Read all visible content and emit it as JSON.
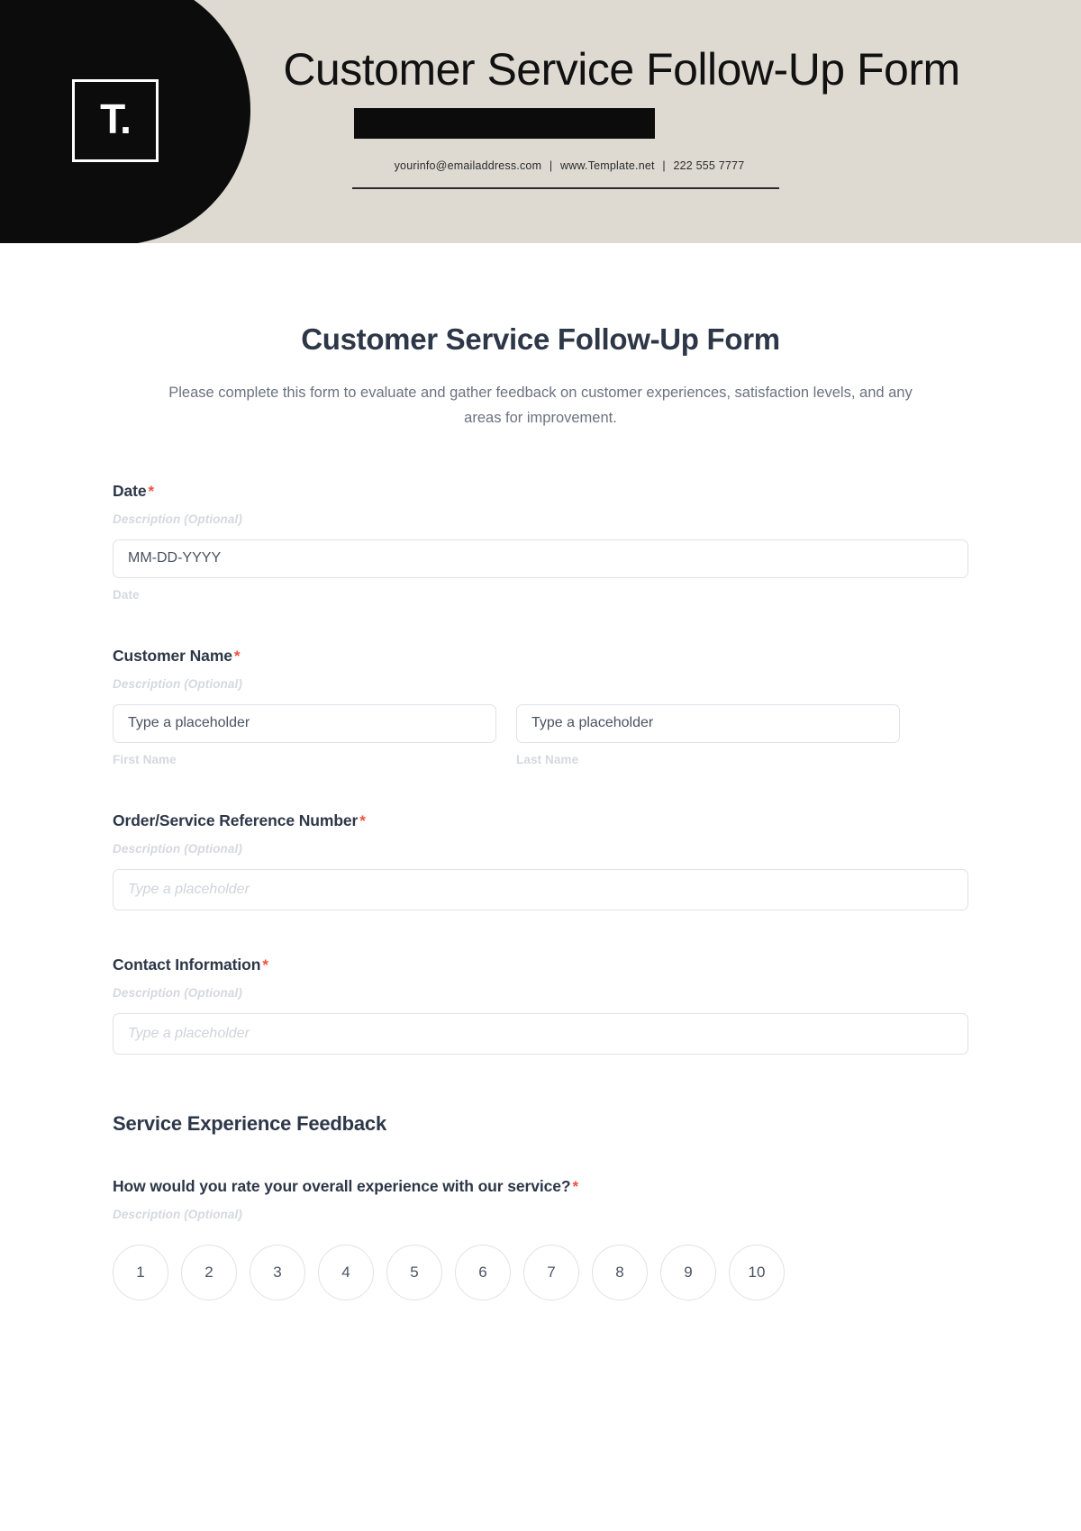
{
  "letterhead": {
    "logo_mark": "T.",
    "title": "Customer Service Follow-Up Form",
    "contact_email": "yourinfo@emailaddress.com",
    "contact_sep1": "|",
    "contact_site": "www.Template.net",
    "contact_sep2": "|",
    "contact_phone": "222 555 7777",
    "bg_color": "#dedad2",
    "brand_color": "#0c0c0c"
  },
  "form": {
    "title": "Customer Service Follow-Up Form",
    "description": "Please complete this form to evaluate and gather feedback on customer experiences, satisfaction levels, and any areas for improvement.",
    "required_marker": "*",
    "hint_text": "Description (Optional)",
    "accent_required_color": "#f2503f",
    "fields": {
      "date": {
        "label": "Date",
        "hint": "Description (Optional)",
        "value": "MM-DD-YYYY",
        "sub_label": "Date"
      },
      "customer_name": {
        "label": "Customer Name",
        "hint": "Description (Optional)",
        "first_value": "Type a placeholder",
        "last_value": "Type a placeholder",
        "first_sub_label": "First Name",
        "last_sub_label": "Last Name"
      },
      "order_reference": {
        "label": "Order/Service Reference Number",
        "hint": "Description (Optional)",
        "placeholder": "Type a placeholder"
      },
      "contact_information": {
        "label": "Contact Information",
        "hint": "Description (Optional)",
        "placeholder": "Type a placeholder"
      }
    },
    "section": {
      "heading": "Service Experience Feedback",
      "question": "How would you rate your overall experience with our service?",
      "question_hint": "Description (Optional)",
      "rating_options": [
        "1",
        "2",
        "3",
        "4",
        "5",
        "6",
        "7",
        "8",
        "9",
        "10"
      ]
    }
  }
}
